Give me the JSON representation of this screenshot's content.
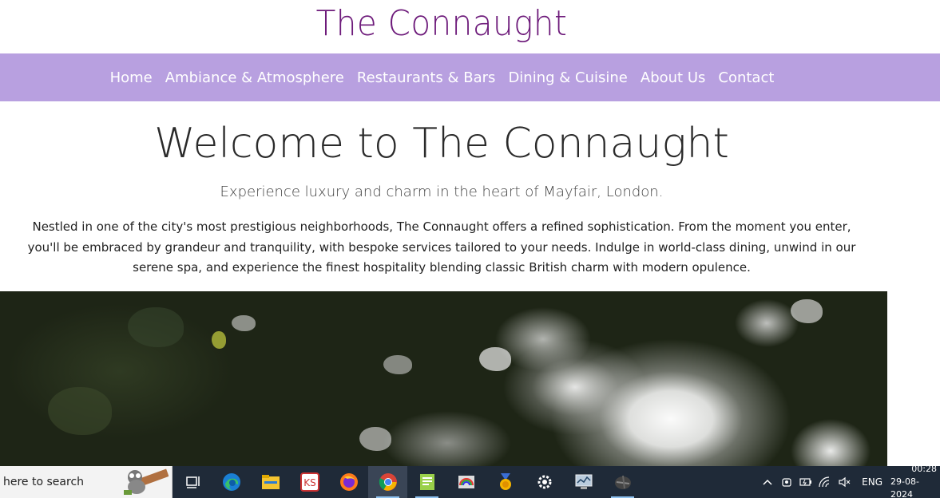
{
  "site": {
    "title": "The Connaught"
  },
  "nav": {
    "items": [
      "Home",
      "Ambiance & Atmosphere",
      "Restaurants & Bars",
      "Dining & Cuisine",
      "About Us",
      "Contact"
    ]
  },
  "hero": {
    "heading": "Welcome to The Connaught",
    "subheading": "Experience luxury and charm in the heart of Mayfair, London.",
    "paragraph": "Nestled in one of the city's most prestigious neighborhoods, The Connaught offers a refined sophistication. From the moment you enter, you'll be embraced by grandeur and tranquility, with bespoke services tailored to your needs. Indulge in world-class dining, unwind in our serene spa, and experience the finest hospitality blending classic British charm with modern opulence."
  },
  "taskbar": {
    "search_text": "here to search",
    "apps": [
      "task-view",
      "edge",
      "file-explorer",
      "app-ks",
      "firefox",
      "chrome",
      "notepad-plus",
      "paint",
      "medal",
      "settings",
      "monitor",
      "app-dark"
    ],
    "active_app": "chrome",
    "language": "ENG",
    "time": "00:28",
    "date": "29-08-2024"
  },
  "colors": {
    "title": "#6d1a7a",
    "navbar": "#b8a0e0",
    "taskbar": "#1f2a38"
  }
}
